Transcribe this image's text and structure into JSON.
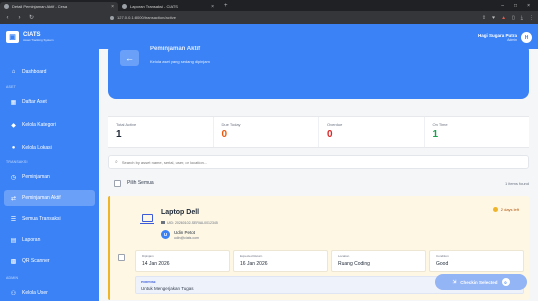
{
  "browser": {
    "tabs": [
      {
        "title": "Detail Peminjaman Aktif - Cesa"
      },
      {
        "title": "Laporan Transaksi - CIATS"
      }
    ],
    "url": "127.0.0.1:8000/transaction/active",
    "window_controls": [
      "–",
      "□",
      "×"
    ]
  },
  "sidebar": {
    "brand_title": "CIATS",
    "brand_subtitle": "Asset Tracking System",
    "sections": [
      "ASET",
      "TRANSAKSI",
      "ADMIN"
    ],
    "items": [
      {
        "label": "Dashboard",
        "icon": "home-icon"
      },
      {
        "label": "Daftar Aset",
        "icon": "box-icon"
      },
      {
        "label": "Kelola Kategori",
        "icon": "tag-icon"
      },
      {
        "label": "Kelola Lokasi",
        "icon": "pin-icon"
      },
      {
        "label": "Peminjaman",
        "icon": "clock-icon"
      },
      {
        "label": "Peminjaman Aktif",
        "icon": "swap-icon"
      },
      {
        "label": "Semua Transaksi",
        "icon": "list-icon"
      },
      {
        "label": "Laporan",
        "icon": "report-icon"
      },
      {
        "label": "QR Scanner",
        "icon": "qr-icon"
      },
      {
        "label": "Kelola User",
        "icon": "users-icon"
      }
    ]
  },
  "user": {
    "name": "Hagi Sugara Putra",
    "role": "Admin",
    "initial": "H"
  },
  "hero": {
    "title": "Peminjaman Aktif",
    "subtitle": "Kelola aset yang sedang dipinjam"
  },
  "stats": [
    {
      "label": "Total Active",
      "value": "1",
      "color": "#1f2937"
    },
    {
      "label": "Due Today",
      "value": "0",
      "color": "#ea580c"
    },
    {
      "label": "Overdue",
      "value": "0",
      "color": "#dc2626"
    },
    {
      "label": "On Time",
      "value": "1",
      "color": "#16a34a"
    }
  ],
  "search": {
    "placeholder": "Search by asset name, serial, user, or location..."
  },
  "select_all": {
    "label": "Pilih Semua",
    "count": "1 items found"
  },
  "card": {
    "asset_name": "Laptop Dell",
    "uid": "UID: 20260102-SERIAL0012345",
    "borrower_initial": "U",
    "borrower_name": "Udin Petot",
    "borrower_email": "udin@ciats.com",
    "days_left": "2 days left",
    "info": [
      {
        "label": "Dipinjam",
        "value": "14 Jan 2026"
      },
      {
        "label": "Expected Return",
        "value": "16 Jan 2026"
      },
      {
        "label": "Location",
        "value": "Ruang Coding"
      },
      {
        "label": "Condition",
        "value": "Good"
      }
    ],
    "purpose_label": "PURPOSE",
    "purpose_text": "Untuk Mengerjakan Tugas"
  },
  "checkin": {
    "label": "Checkin Selected",
    "count": "0"
  }
}
